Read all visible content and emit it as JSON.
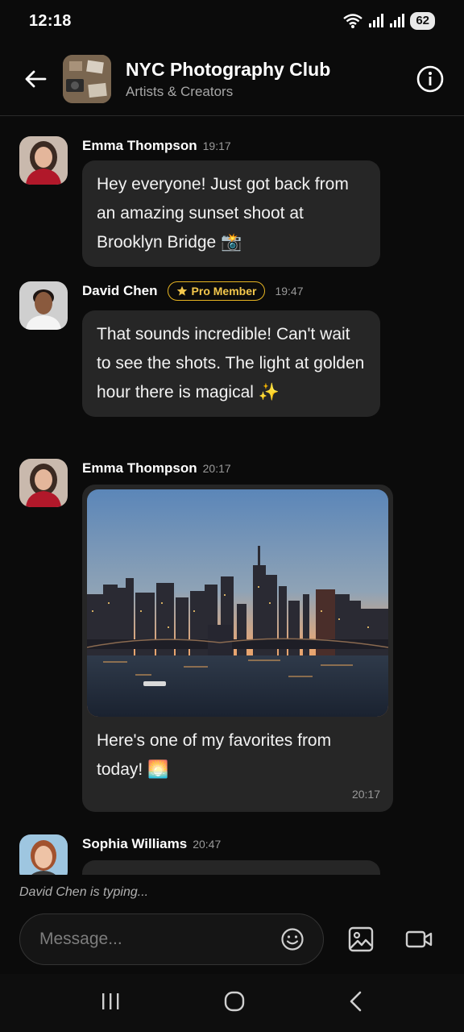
{
  "status_bar": {
    "time": "12:18",
    "battery": "62"
  },
  "header": {
    "title": "NYC Photography Club",
    "subtitle": "Artists & Creators"
  },
  "messages": [
    {
      "sender": "Emma Thompson",
      "time": "19:17",
      "text": "Hey everyone! Just got back from an amazing sunset shoot at Brooklyn Bridge 📸"
    },
    {
      "sender": "David Chen",
      "badge": "Pro Member",
      "time": "19:47",
      "text": "That sounds incredible! Can't wait to see the shots. The light at golden hour there is magical ✨"
    },
    {
      "sender": "Emma Thompson",
      "time": "20:17",
      "caption": "Here's one of my favorites from today! 🌅",
      "image_time": "20:17"
    },
    {
      "sender": "Sophia Williams",
      "time": "20:47"
    }
  ],
  "typing_indicator": "David Chen is typing...",
  "composer": {
    "placeholder": "Message..."
  },
  "colors": {
    "background": "#0b0b0b",
    "bubble": "#262626",
    "badge_gold": "#e6b422"
  }
}
